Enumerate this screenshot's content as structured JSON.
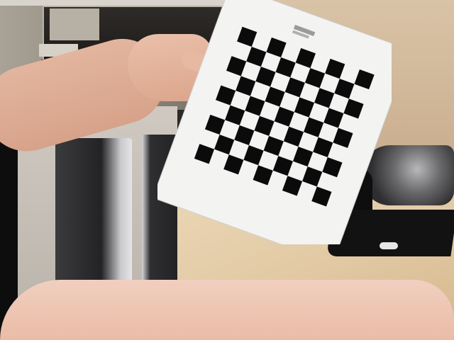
{
  "scene": {
    "type": "photo",
    "main_object": "checkerboard-calibration-target",
    "colors": {
      "board_paper": "#f3f3f2",
      "board_square": "#0b0b0b",
      "desk": "#e2c9a4",
      "wall": "#cdb394"
    }
  },
  "board": {
    "label_text": "",
    "squares_rows": 9,
    "squares_cols": 9
  }
}
